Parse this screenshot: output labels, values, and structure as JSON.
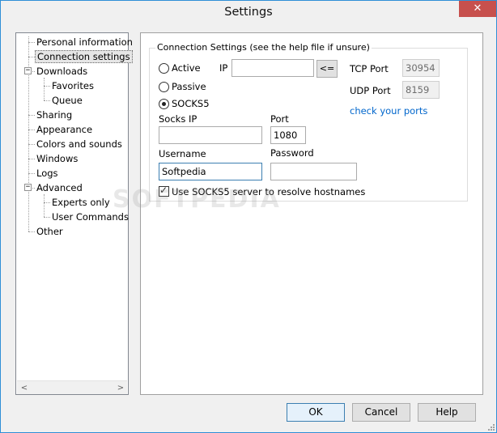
{
  "window": {
    "title": "Settings",
    "close_glyph": "✕"
  },
  "tree": {
    "items": [
      {
        "label": "Personal information"
      },
      {
        "label": "Connection settings",
        "selected": true
      },
      {
        "label": "Downloads",
        "expander": "⊟"
      },
      {
        "label": "Favorites"
      },
      {
        "label": "Queue"
      },
      {
        "label": "Sharing"
      },
      {
        "label": "Appearance"
      },
      {
        "label": "Colors and sounds"
      },
      {
        "label": "Windows"
      },
      {
        "label": "Logs"
      },
      {
        "label": "Advanced",
        "expander": "⊟"
      },
      {
        "label": "Experts only"
      },
      {
        "label": "User Commands"
      },
      {
        "label": "Other"
      }
    ],
    "scroll_left": "<",
    "scroll_right": ">"
  },
  "connection": {
    "group_title": "Connection Settings (see the help file if unsure)",
    "mode_active": "Active",
    "mode_passive": "Passive",
    "mode_socks5": "SOCKS5",
    "selected_mode": "SOCKS5",
    "ip_label": "IP",
    "ip_value": "",
    "ip_button": "<=",
    "tcp_label": "TCP Port",
    "tcp_value": "30954",
    "udp_label": "UDP Port",
    "udp_value": "8159",
    "check_ports_link": "check your ports",
    "socks_ip_label": "Socks IP",
    "socks_ip_value": "",
    "port_label": "Port",
    "port_value": "1080",
    "username_label": "Username",
    "username_value": "Softpedia",
    "password_label": "Password",
    "password_value": "",
    "resolve_label": "Use SOCKS5 server to resolve hostnames",
    "resolve_checked": true
  },
  "watermark": "SOFTPEDIA",
  "buttons": {
    "ok": "OK",
    "cancel": "Cancel",
    "help": "Help"
  },
  "colors": {
    "accent": "#2e8fd6",
    "close": "#c7504d",
    "link": "#0066cc"
  }
}
